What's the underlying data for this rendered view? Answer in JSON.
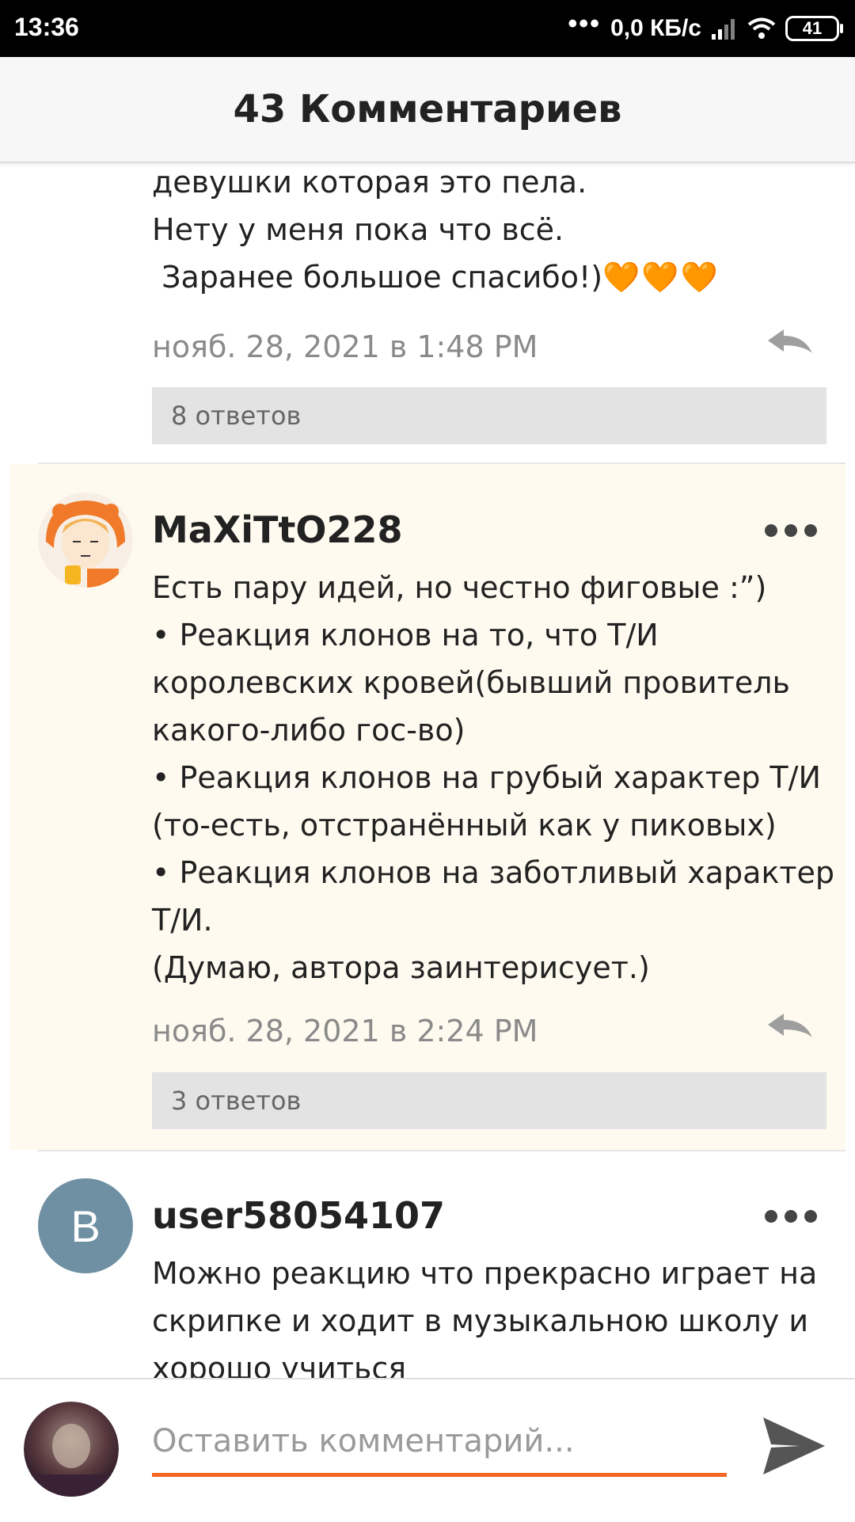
{
  "status_bar": {
    "time": "13:36",
    "dots": "•••",
    "network_speed": "0,0 КБ/с",
    "battery": "41"
  },
  "header": {
    "title": "43 Комментариев"
  },
  "comments": [
    {
      "text_lines": [
        "девушки которая это пела.",
        "Нету у меня пока что всё.",
        " Заранее большое спасибо!)"
      ],
      "hearts": "🧡🧡🧡",
      "timestamp": "нояб. 28, 2021 в 1:48 PM",
      "replies": "8 ответов"
    },
    {
      "username": "MaXiTtO228",
      "text_lines": [
        "Есть пару идей, но честно фиговые :”)",
        "• Реакция клонов на то, что Т/И",
        "королевских кровей(бывший провитель",
        "какого-либо гос-во)",
        "• Реакция клонов на грубый характер Т/И",
        "(то-есть, отстранённый как у пиковых)",
        "• Реакция клонов на заботливый характер",
        "Т/И.",
        "(Думаю, автора заинтерисует.)"
      ],
      "timestamp": "нояб. 28, 2021 в 2:24 PM",
      "replies": "3 ответов"
    },
    {
      "username": "user58054107",
      "avatar_letter": "B",
      "text_lines": [
        "Можно реакцию что прекрасно играет на",
        "скрипке и ходит в музыкальною школу и",
        "хорошо учиться"
      ]
    }
  ],
  "comment_input": {
    "placeholder": "Оставить комментарий..."
  },
  "colors": {
    "accent": "#f26522",
    "highlight_bg": "#fffaf0",
    "replies_bg": "#e3e3e3",
    "avatar_b": "#6f8fa3"
  },
  "icons": {
    "reply": "reply-arrow-icon",
    "more": "more-dots-icon",
    "send": "send-icon"
  }
}
